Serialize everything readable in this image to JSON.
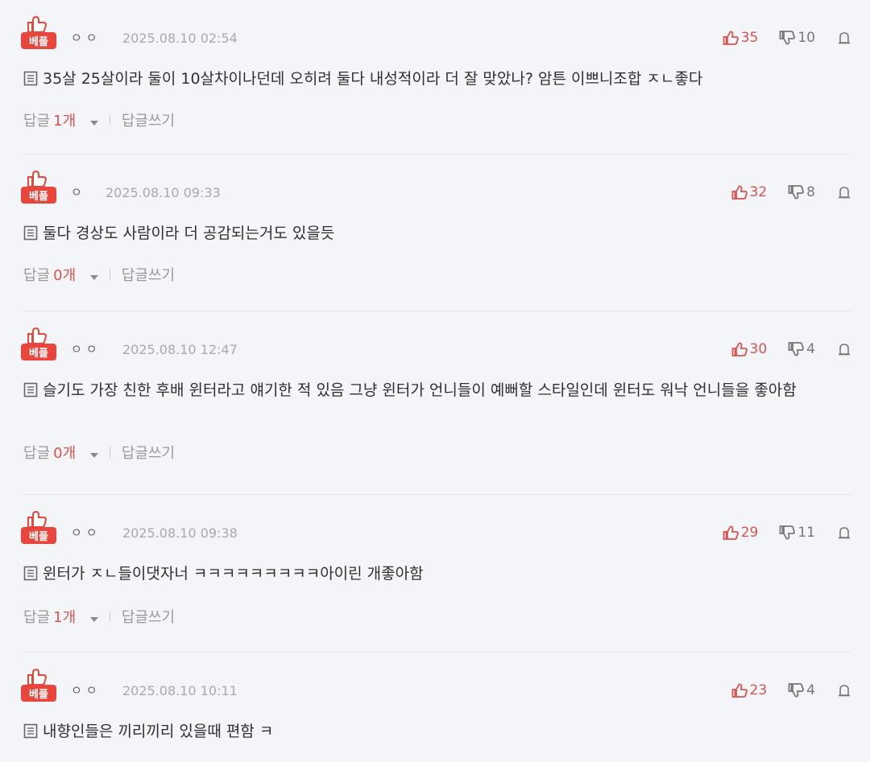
{
  "comments": [
    {
      "badge_label": "베플",
      "nickname": "ㅇㅇ",
      "date": "2025.08.10 02:54",
      "likes": "35",
      "dislikes": "10",
      "text": "35살 25살이라 둘이 10살차이나던데 오히려 둘다 내성적이라 더 잘 맞았나? 암튼 이쁘니조합 ㅈㄴ좋다",
      "reply_label": "답글",
      "reply_count": "1개",
      "write_reply": "답글쓰기"
    },
    {
      "badge_label": "베플",
      "nickname": "ㅇ",
      "date": "2025.08.10 09:33",
      "likes": "32",
      "dislikes": "8",
      "text": "둘다 경상도 사람이라 더 공감되는거도 있을듯",
      "reply_label": "답글",
      "reply_count": "0개",
      "write_reply": "답글쓰기"
    },
    {
      "badge_label": "베플",
      "nickname": "ㅇㅇ",
      "date": "2025.08.10 12:47",
      "likes": "30",
      "dislikes": "4",
      "text": "슬기도 가장 친한 후배 윈터라고 얘기한 적 있음 그냥 윈터가 언니들이 예뻐할 스타일인데 윈터도 워낙 언니들을 좋아함",
      "reply_label": "답글",
      "reply_count": "0개",
      "write_reply": "답글쓰기"
    },
    {
      "badge_label": "베플",
      "nickname": "ㅇㅇ",
      "date": "2025.08.10 09:38",
      "likes": "29",
      "dislikes": "11",
      "text": "윈터가 ㅈㄴ들이댓자너 ㅋㅋㅋㅋㅋㅋㅋㅋㅋ아이린 개좋아함",
      "reply_label": "답글",
      "reply_count": "1개",
      "write_reply": "답글쓰기"
    },
    {
      "badge_label": "베플",
      "nickname": "ㅇㅇ",
      "date": "2025.08.10 10:11",
      "likes": "23",
      "dislikes": "4",
      "text": "내향인들은 끼리끼리 있을때 편함 ㅋ"
    }
  ],
  "colors": {
    "accent": "#d9534f",
    "badge": "#e8453c",
    "background": "#f4f5f9"
  },
  "icons": [
    "best-badge-icon",
    "thumbs-up-icon",
    "thumbs-down-icon",
    "report-icon",
    "document-icon",
    "caret-down-icon"
  ]
}
